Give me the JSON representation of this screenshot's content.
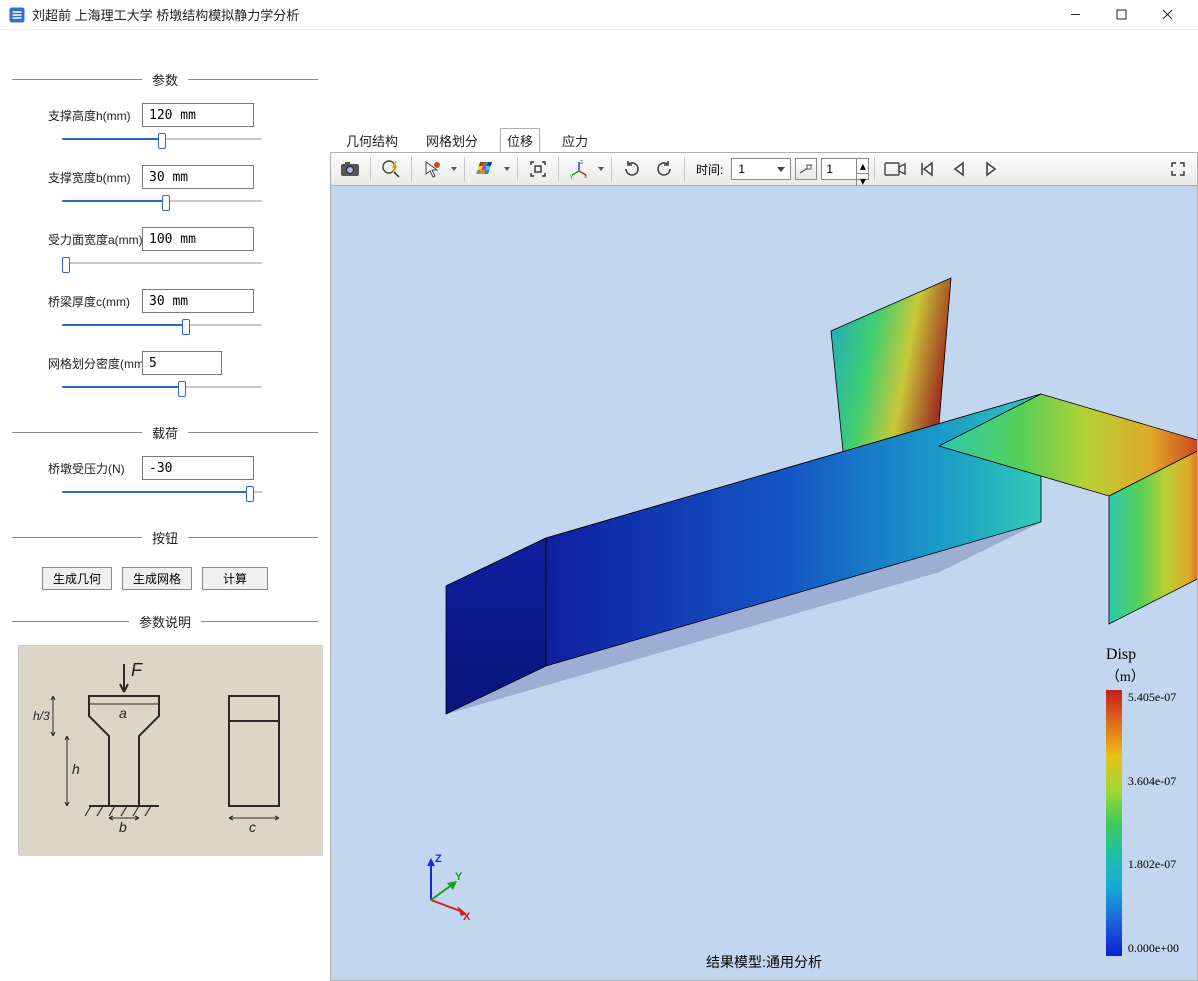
{
  "window": {
    "title": "刘超前  上海理工大学 桥墩结构模拟静力学分析"
  },
  "groups": {
    "params": "参数",
    "load": "载荷",
    "buttons": "按钮",
    "explain": "参数说明"
  },
  "params": {
    "h": {
      "label": "支撑高度h(mm)",
      "value": "120 mm",
      "pos": 50
    },
    "b": {
      "label": "支撑宽度b(mm)",
      "value": "30 mm",
      "pos": 52
    },
    "a": {
      "label": "受力面宽度a(mm)",
      "value": "100 mm",
      "pos": 2
    },
    "c": {
      "label": "桥梁厚度c(mm)",
      "value": "30 mm",
      "pos": 62
    },
    "mesh": {
      "label": "网格划分密度(mm)",
      "value": "5",
      "pos": 60
    }
  },
  "load": {
    "f": {
      "label": "桥墩受压力(N)",
      "value": "-30",
      "pos": 94
    }
  },
  "buttons": {
    "geom": "生成几何",
    "mesh": "生成网格",
    "calc": "计算"
  },
  "tabs": {
    "geom": "几何结构",
    "mesh": "网格划分",
    "disp": "位移",
    "stress": "应力"
  },
  "toolbar": {
    "time_label": "时间:",
    "time_value": "1",
    "frame_value": "1"
  },
  "viewport": {
    "result_label": "结果模型:通用分析"
  },
  "triad": {
    "x": "X",
    "y": "Y",
    "z": "Z"
  },
  "legend": {
    "title": "Disp",
    "unit": "（m）",
    "ticks": [
      "5.405e-07",
      "3.604e-07",
      "1.802e-07",
      "0.000e+00"
    ]
  },
  "sketch": {
    "F": "F",
    "a": "a",
    "h": "h",
    "h3": "h/3",
    "b": "b",
    "c": "c"
  }
}
